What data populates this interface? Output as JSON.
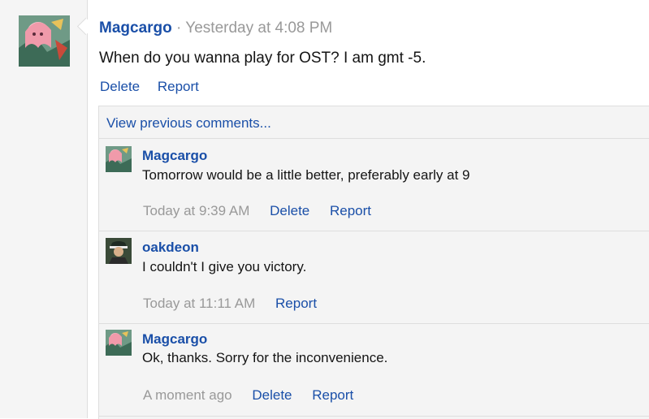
{
  "post": {
    "author": "Magcargo",
    "separator": "·",
    "time": "Yesterday at 4:08 PM",
    "text": "When do you wanna play for OST? I am gmt -5.",
    "actions": {
      "delete": "Delete",
      "report": "Report"
    }
  },
  "comments_section": {
    "view_previous": "View previous comments...",
    "items": [
      {
        "author": "Magcargo",
        "text": "Tomorrow would be a little better, preferably early at 9",
        "time": "Today at 9:39 AM",
        "delete": "Delete",
        "report": "Report"
      },
      {
        "author": "oakdeon",
        "text": "I couldn't I give you victory.",
        "time": "Today at 11:11 AM",
        "report": "Report"
      },
      {
        "author": "Magcargo",
        "text": "Ok, thanks. Sorry for the inconvenience.",
        "time": "A moment ago",
        "delete": "Delete",
        "report": "Report"
      }
    ]
  }
}
